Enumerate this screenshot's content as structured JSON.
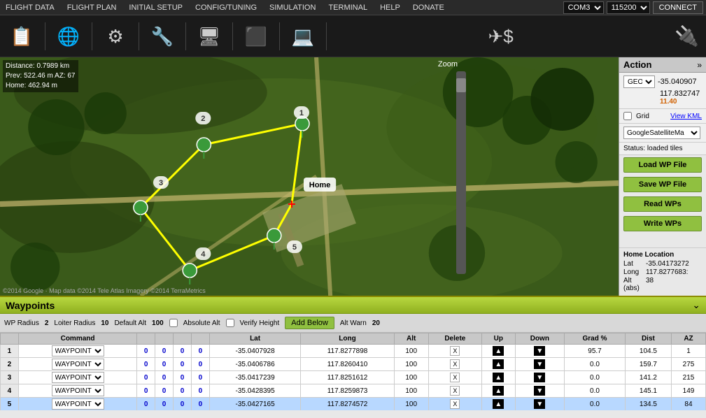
{
  "menubar": {
    "items": [
      "FLIGHT DATA",
      "FLIGHT PLAN",
      "INITIAL SETUP",
      "CONFIG/TUNING",
      "SIMULATION",
      "TERMINAL",
      "HELP",
      "DONATE"
    ],
    "com_port": "COM3",
    "baud_rate": "115200",
    "connect_label": "CONNECT"
  },
  "toolbar": {
    "buttons": [
      {
        "label": "FLIGHT DATA",
        "icon": "📋"
      },
      {
        "label": "FLIGHT PLAN",
        "icon": "🌐"
      },
      {
        "label": "INITIAL SETUP",
        "icon": "⚙"
      },
      {
        "label": "CONFIG/TUNING",
        "icon": "🔧"
      },
      {
        "label": "SIMULATION",
        "icon": "🖥"
      },
      {
        "label": "TERMINAL",
        "icon": "⬛"
      },
      {
        "label": "HELP",
        "icon": "💻"
      },
      {
        "label": "DONATE",
        "icon": "✈"
      }
    ]
  },
  "map": {
    "info": {
      "distance": "Distance: 0.7989 km",
      "prev": "Prev: 522.46 m AZ: 67",
      "home": "Home: 462.94 m"
    },
    "zoom_label": "Zoom",
    "copyright": "©2014 Google · Map data ©2014 Tele Atlas Imagery ©2014 TerraMetrics"
  },
  "action": {
    "title": "Action",
    "coord_type": "GEO",
    "lat": "-35.040907",
    "lon": "117.832747",
    "alt": "11.40",
    "grid_label": "Grid",
    "view_kml": "View KML",
    "map_type": "GoogleSatelliteMa",
    "status": "Status: loaded tiles",
    "load_wp": "Load WP File",
    "save_wp": "Save WP File",
    "read_wps": "Read WPs",
    "write_wps": "Write WPs",
    "home_location": {
      "title": "Home Location",
      "lat_label": "Lat",
      "lat_value": "-35.04173272",
      "long_label": "Long",
      "long_value": "117.8277683:",
      "alt_label": "Alt (abs)",
      "alt_value": "38"
    }
  },
  "waypoints": {
    "title": "Waypoints",
    "options": {
      "wp_radius_label": "WP Radius",
      "wp_radius_value": "2",
      "loiter_radius_label": "Loiter Radius",
      "loiter_radius_value": "10",
      "default_alt_label": "Default Alt",
      "default_alt_value": "100",
      "absolute_alt_label": "Absolute Alt",
      "verify_height_label": "Verify Height",
      "add_below_label": "Add Below",
      "alt_warn_label": "Alt Warn",
      "alt_warn_value": "20"
    },
    "table_headers": [
      "",
      "Command",
      "",
      "",
      "",
      "",
      "Lat",
      "Long",
      "Alt",
      "Delete",
      "Up",
      "Down",
      "Grad %",
      "Dist",
      "AZ"
    ],
    "rows": [
      {
        "num": "1",
        "command": "WAYPOINT",
        "c1": "0",
        "c2": "0",
        "c3": "0",
        "c4": "0",
        "lat": "-35.0407928",
        "lon": "117.8277898",
        "alt": "100",
        "delete": "X",
        "grad": "95.7",
        "dist": "104.5",
        "az": "1",
        "selected": false
      },
      {
        "num": "2",
        "command": "WAYPOINT",
        "c1": "0",
        "c2": "0",
        "c3": "0",
        "c4": "0",
        "lat": "-35.0406786",
        "lon": "117.8260410",
        "alt": "100",
        "delete": "X",
        "grad": "0.0",
        "dist": "159.7",
        "az": "275",
        "selected": false
      },
      {
        "num": "3",
        "command": "WAYPOINT",
        "c1": "0",
        "c2": "0",
        "c3": "0",
        "c4": "0",
        "lat": "-35.0417239",
        "lon": "117.8251612",
        "alt": "100",
        "delete": "X",
        "grad": "0.0",
        "dist": "141.2",
        "az": "215",
        "selected": false
      },
      {
        "num": "4",
        "command": "WAYPOINT",
        "c1": "0",
        "c2": "0",
        "c3": "0",
        "c4": "0",
        "lat": "-35.0428395",
        "lon": "117.8259873",
        "alt": "100",
        "delete": "X",
        "grad": "0.0",
        "dist": "145.1",
        "az": "149",
        "selected": false
      },
      {
        "num": "5",
        "command": "WAYPOINT",
        "c1": "0",
        "c2": "0",
        "c3": "0",
        "c4": "0",
        "lat": "-35.0427165",
        "lon": "117.8274572",
        "alt": "100",
        "delete": "X",
        "grad": "0.0",
        "dist": "134.5",
        "az": "84",
        "selected": true
      }
    ]
  }
}
